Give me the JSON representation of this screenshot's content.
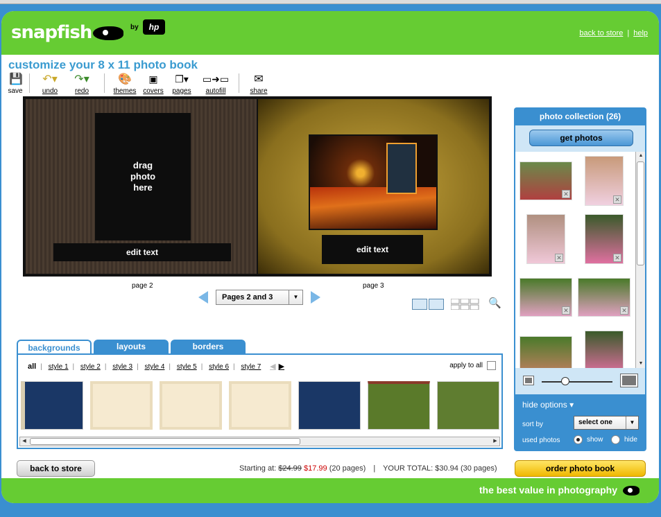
{
  "header": {
    "logo_text": "snapfish",
    "by": "by",
    "hp": "hp",
    "links": [
      "back to store",
      "help"
    ],
    "link_sep": "|"
  },
  "page_title": "customize your 8 x 11 photo book",
  "toolbar": {
    "save": "save",
    "undo": "undo",
    "redo": "redo",
    "themes": "themes",
    "covers": "covers",
    "pages": "pages",
    "autofill": "autofill",
    "share": "share"
  },
  "book": {
    "drop_text": "drag\nphoto\nhere",
    "left_edit": "edit text",
    "right_edit": "edit text",
    "left_label": "page 2",
    "right_label": "page 3"
  },
  "page_nav": {
    "selected": "Pages 2 and 3"
  },
  "tabs": [
    "backgrounds",
    "layouts",
    "borders"
  ],
  "styles": {
    "all": "all",
    "items": [
      "style 1",
      "style 2",
      "style 3",
      "style 4",
      "style 5",
      "style 6",
      "style 7"
    ],
    "apply_all": "apply to all"
  },
  "sidebar": {
    "title": "photo collection (26)",
    "get_photos": "get photos",
    "hide_options": "hide options",
    "sort_by": "sort by",
    "sort_value": "select one",
    "used_photos": "used photos",
    "show": "show",
    "hide": "hide"
  },
  "footer_bar": {
    "back_to_store": "back to store",
    "starting_at": "Starting at:",
    "old_price": "$24.99",
    "new_price": "$17.99",
    "pages_note": "(20 pages)",
    "sep": "|",
    "total": "YOUR TOTAL: $30.94 (30 pages)",
    "order": "order photo book"
  },
  "tagline": "the best value in photography",
  "colors": {
    "green": "#66cc33",
    "blue": "#3a8fd0",
    "price_red": "#cc0000"
  }
}
